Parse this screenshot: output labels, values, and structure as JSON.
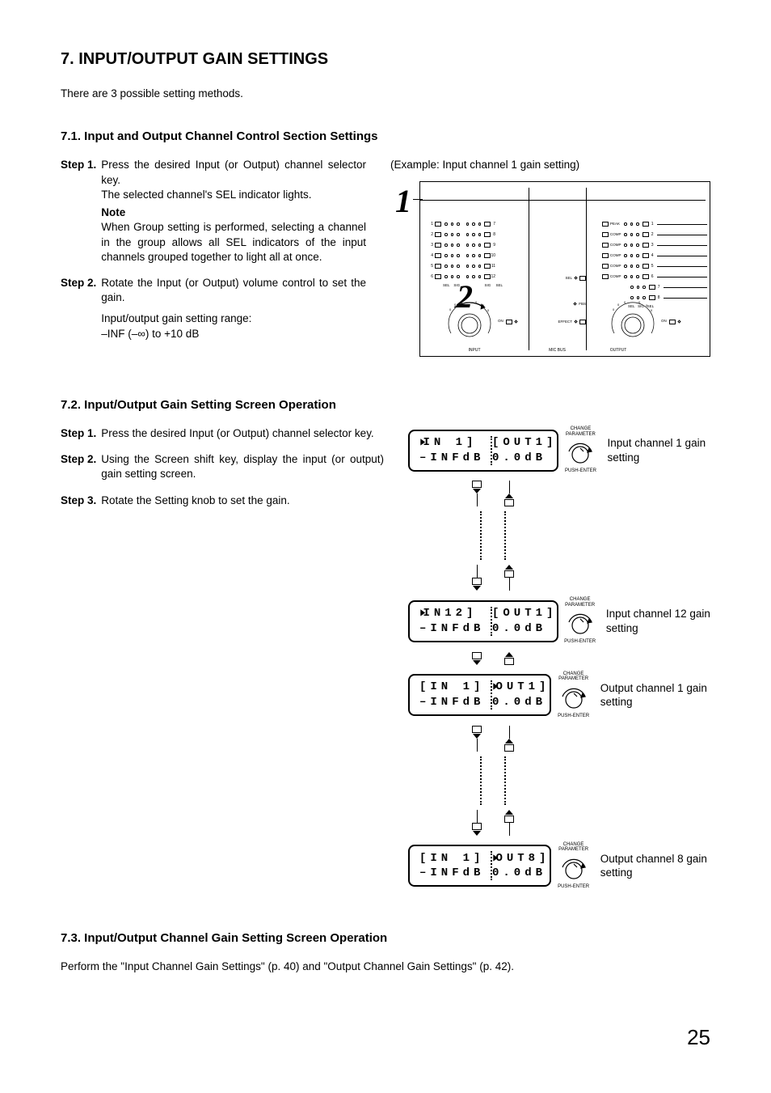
{
  "h1": "7. INPUT/OUTPUT GAIN SETTINGS",
  "intro": "There are 3 possible setting methods.",
  "s71": {
    "title": "7.1. Input and Output Channel Control Section Settings",
    "step1_label": "Step 1.",
    "step1_a": "Press the desired Input (or Output) channel selector key.",
    "step1_b": "The selected channel's SEL indicator lights.",
    "note_label": "Note",
    "note_body": "When Group setting is performed, selecting a channel in the group allows all SEL indicators of the input channels grouped together to light all at once.",
    "step2_label": "Step 2.",
    "step2_a": "Rotate the Input (or Output) volume control to set the gain.",
    "step2_b1": "Input/output gain setting range:",
    "step2_b2": "–INF (–∞) to +10 dB",
    "example_cap": "(Example: Input channel 1 gain setting)",
    "panel": {
      "num1": "1",
      "num2": "2",
      "input_label": "INPUT",
      "micbus_label": "MIC BUS",
      "output_label": "OUTPUT",
      "sel": "SEL",
      "fbs": "FBS",
      "effect": "EFFECT",
      "on": "ON",
      "peak": "PEAK",
      "sig": "SIG",
      "input_nums": [
        "1",
        "2",
        "3",
        "4",
        "5",
        "6",
        "7",
        "8",
        "9",
        "10",
        "11",
        "12"
      ],
      "output_nums": [
        "1",
        "2",
        "3",
        "4",
        "5",
        "6",
        "7",
        "8"
      ],
      "out_lamps": [
        "PEAK",
        "COMP",
        "COMP",
        "COMP",
        "COMP",
        "COMP"
      ]
    }
  },
  "s72": {
    "title": "7.2. Input/Output Gain Setting Screen Operation",
    "step1_label": "Step 1.",
    "step1": "Press the desired Input (or Output) channel selector key.",
    "step2_label": "Step 2.",
    "step2": "Using the Screen shift key, display the input (or output) gain setting screen.",
    "step3_label": "Step 3.",
    "step3": "Rotate the Setting knob to set the gain.",
    "knob_top": "CHANGE\nPARAMETER",
    "knob_bot": "PUSH-ENTER",
    "screens": [
      {
        "l1a": "IN 1]",
        "l1b": "[OUT1]",
        "l2a": "–INFdB",
        "l2b": "0.0dB",
        "cursor": "left",
        "desc": "Input channel 1 gain setting"
      },
      {
        "l1a": "IN12]",
        "l1b": "[OUT1]",
        "l2a": "–INFdB",
        "l2b": "0.0dB",
        "cursor": "left",
        "desc": "Input channel 12 gain setting"
      },
      {
        "l1a": "[IN 1]",
        "l1b": "OUT1]",
        "l2a": "–INFdB",
        "l2b": "0.0dB",
        "cursor": "right",
        "desc": "Output channel 1 gain setting"
      },
      {
        "l1a": "[IN 1]",
        "l1b": "OUT8]",
        "l2a": "–INFdB",
        "l2b": "0.0dB",
        "cursor": "right",
        "desc": "Output channel 8 gain setting"
      }
    ]
  },
  "s73": {
    "title": "7.3. Input/Output Channel Gain Setting Screen Operation",
    "body": "Perform the \"Input Channel Gain Settings\" (p. 40) and \"Output Channel Gain Settings\" (p. 42)."
  },
  "page_num": "25"
}
